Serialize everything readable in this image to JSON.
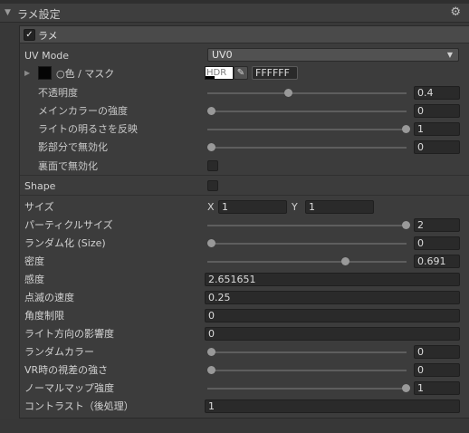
{
  "section": {
    "title": "ラメ設定",
    "gear_icon": "gear-icon"
  },
  "panel": {
    "title": "ラメ",
    "enabled": true,
    "uv_mode": {
      "label": "UV Mode",
      "value": "UV0"
    },
    "color": {
      "label": "○色 / マスク",
      "swatch": "#050505",
      "hdr_label": "HDR",
      "hex": "FFFFFF"
    },
    "opacity": {
      "label": "不透明度",
      "value": "0.4",
      "fraction": 0.4
    },
    "main_color_strength": {
      "label": "メインカラーの強度",
      "value": "0",
      "fraction": 0
    },
    "light_brightness": {
      "label": "ライトの明るさを反映",
      "value": "1",
      "fraction": 1
    },
    "shadow_disable": {
      "label": "影部分で無効化",
      "value": "0",
      "fraction": 0
    },
    "backface_disable": {
      "label": "裏面で無効化",
      "checked": false
    },
    "shape": {
      "label": "Shape",
      "checked": false
    },
    "size": {
      "label": "サイズ",
      "x_label": "X",
      "x": "1",
      "y_label": "Y",
      "y": "1"
    },
    "particle_size": {
      "label": "パーティクルサイズ",
      "value": "2",
      "fraction": 1
    },
    "randomize_size": {
      "label": "ランダム化 (Size)",
      "value": "0",
      "fraction": 0
    },
    "density": {
      "label": "密度",
      "value": "0.691",
      "fraction": 0.691
    },
    "sensitivity": {
      "label": "感度",
      "value": "2.651651"
    },
    "blink_speed": {
      "label": "点滅の速度",
      "value": "0.25"
    },
    "angle_limit": {
      "label": "角度制限",
      "value": "0"
    },
    "light_direction": {
      "label": "ライト方向の影響度",
      "value": "0"
    },
    "random_color": {
      "label": "ランダムカラー",
      "value": "0",
      "fraction": 0
    },
    "vr_parallax": {
      "label": "VR時の視差の強さ",
      "value": "0",
      "fraction": 0
    },
    "normal_map": {
      "label": "ノーマルマップ強度",
      "value": "1",
      "fraction": 1
    },
    "contrast": {
      "label": "コントラスト（後処理）",
      "value": "1"
    }
  }
}
